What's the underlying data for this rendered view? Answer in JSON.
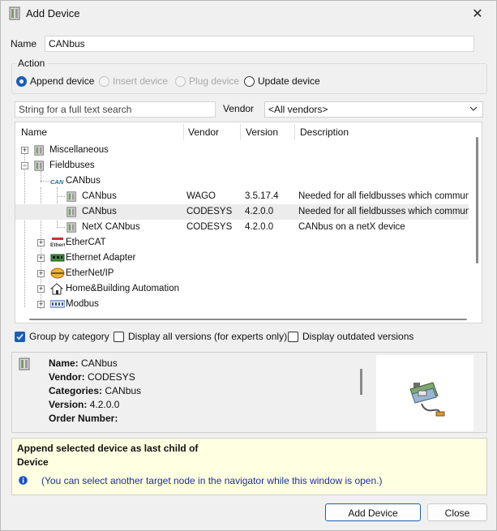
{
  "window": {
    "title": "Add Device",
    "close_glyph": "✕",
    "icon": "device-icon"
  },
  "name_field": {
    "label": "Name",
    "value": "CANbus"
  },
  "action": {
    "legend": "Action",
    "options": [
      {
        "label": "Append device",
        "selected": true,
        "enabled": true
      },
      {
        "label": "Insert device",
        "selected": false,
        "enabled": false
      },
      {
        "label": "Plug device",
        "selected": false,
        "enabled": false
      },
      {
        "label": "Update device",
        "selected": false,
        "enabled": true
      }
    ]
  },
  "search": {
    "placeholder": "String for a full text search",
    "value": ""
  },
  "vendor_filter": {
    "label": "Vendor",
    "value": "<All vendors>"
  },
  "tree": {
    "columns": [
      "Name",
      "Vendor",
      "Version",
      "Description"
    ],
    "rows": [
      {
        "name": "Miscellaneous",
        "vendor": "",
        "version": "",
        "description": "",
        "expander": "+",
        "icon": "device-icon"
      },
      {
        "name": "Fieldbuses",
        "vendor": "",
        "version": "",
        "description": "",
        "expander": "−",
        "icon": "device-icon"
      },
      {
        "name": "CANbus",
        "vendor": "",
        "version": "",
        "description": "",
        "expander": "",
        "icon": "can-logo-icon",
        "icon_text": "CAN"
      },
      {
        "name": "CANbus",
        "vendor": "WAGO",
        "version": "3.5.17.4",
        "description": "Needed for all fieldbusses which communicat",
        "expander": "",
        "icon": "device-icon"
      },
      {
        "name": "CANbus",
        "vendor": "CODESYS",
        "version": "4.2.0.0",
        "description": "Needed for all fieldbusses which communicat",
        "expander": "",
        "icon": "device-icon",
        "selected": true
      },
      {
        "name": "NetX CANbus",
        "vendor": "CODESYS",
        "version": "4.2.0.0",
        "description": "CANbus on a netX device",
        "expander": "",
        "icon": "device-icon"
      },
      {
        "name": "EtherCAT",
        "vendor": "",
        "version": "",
        "description": "",
        "expander": "+",
        "icon": "ethercat-logo-icon"
      },
      {
        "name": "Ethernet Adapter",
        "vendor": "",
        "version": "",
        "description": "",
        "expander": "+",
        "icon": "ethernet-adapter-icon"
      },
      {
        "name": "EtherNet/IP",
        "vendor": "",
        "version": "",
        "description": "",
        "expander": "+",
        "icon": "ethernet-ip-icon"
      },
      {
        "name": "Home&Building Automation",
        "vendor": "",
        "version": "",
        "description": "",
        "expander": "+",
        "icon": "home-icon"
      },
      {
        "name": "Modbus",
        "vendor": "",
        "version": "",
        "description": "",
        "expander": "+",
        "icon": "modbus-icon"
      }
    ]
  },
  "options": {
    "group_by_category": {
      "label": "Group by category",
      "checked": true
    },
    "display_all_versions": {
      "label": "Display all versions (for experts only)",
      "checked": false
    },
    "display_outdated": {
      "label": "Display outdated versions",
      "checked": false
    }
  },
  "info": {
    "name_key": "Name:",
    "name_val": "CANbus",
    "vendor_key": "Vendor:",
    "vendor_val": "CODESYS",
    "categories_key": "Categories:",
    "categories_val": "CANbus",
    "version_key": "Version:",
    "version_val": "4.2.0.0",
    "order_key": "Order Number:",
    "order_val": ""
  },
  "message": {
    "line1": "Append selected device as last child of",
    "line2": "Device",
    "hint": "(You can select another target node in the navigator while this window is open.)"
  },
  "buttons": {
    "add": "Add Device",
    "close": "Close"
  },
  "colors": {
    "accent": "#1a5fb4",
    "message_bg": "#ffffe1",
    "selected_row": "#ececec"
  }
}
